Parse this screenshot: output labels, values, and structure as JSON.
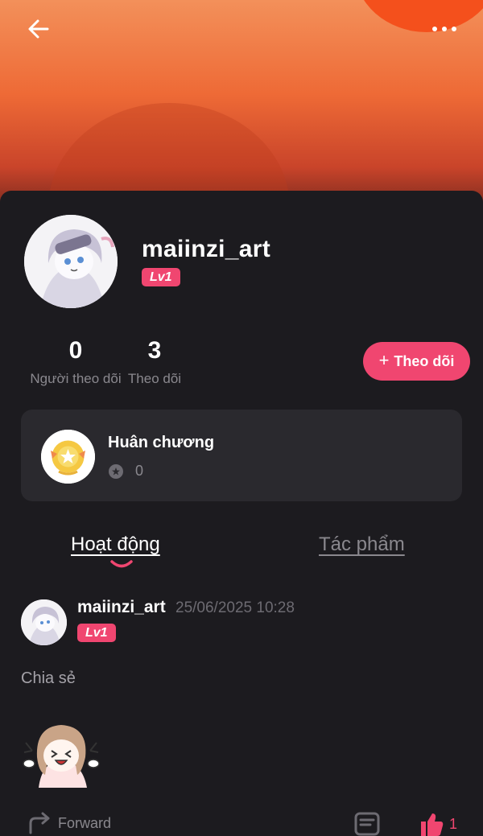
{
  "header": {
    "back_icon": "arrow-left-icon",
    "more_icon": "more-horizontal-icon"
  },
  "profile": {
    "username": "maiinzi_art",
    "level": "Lv1",
    "followers_count": "0",
    "followers_label": "Người theo dõi",
    "following_count": "3",
    "following_label": "Theo dõi",
    "follow_button_label": "Theo dõi"
  },
  "medals": {
    "title": "Huân chương",
    "count": "0"
  },
  "tabs": [
    {
      "label": "Hoạt động",
      "active": true
    },
    {
      "label": "Tác phẩm",
      "active": false
    }
  ],
  "post": {
    "username": "maiinzi_art",
    "level": "Lv1",
    "timestamp": "25/06/2025 10:28",
    "text": "Chia sẻ",
    "forward_label": "Forward",
    "like_count": "1"
  },
  "colors": {
    "accent": "#f04670",
    "background": "#1c1b1f",
    "card": "#2a292e"
  }
}
